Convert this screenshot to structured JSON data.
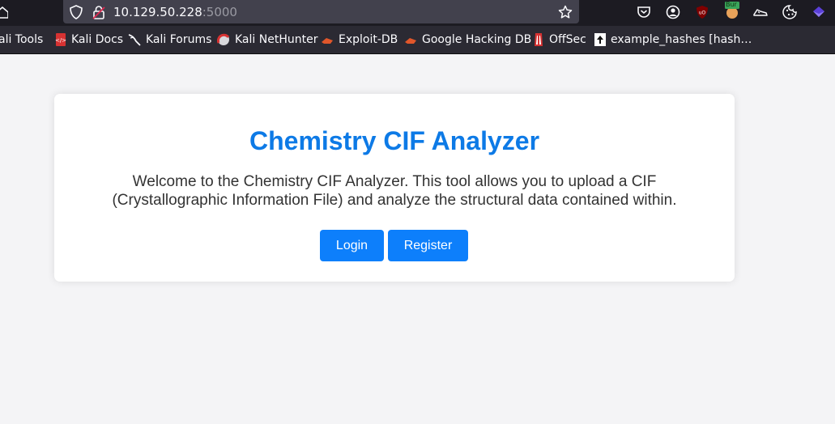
{
  "browser": {
    "url_host": "10.129.50.228",
    "url_port": ":5000",
    "bookmarks": [
      {
        "label": "ali Tools",
        "icon": "kali-tools-icon"
      },
      {
        "label": "Kali Docs",
        "icon": "kali-docs-icon"
      },
      {
        "label": "Kali Forums",
        "icon": "kali-forums-icon"
      },
      {
        "label": "Kali NetHunter",
        "icon": "kali-nethunter-icon"
      },
      {
        "label": "Exploit-DB",
        "icon": "exploit-db-icon"
      },
      {
        "label": "Google Hacking DB",
        "icon": "google-hacking-db-icon"
      },
      {
        "label": "OffSec",
        "icon": "offsec-icon"
      },
      {
        "label": "example_hashes [hash…",
        "icon": "hashcat-icon"
      }
    ],
    "extension_badge": "Bur"
  },
  "page": {
    "title": "Chemistry CIF Analyzer",
    "description": "Welcome to the Chemistry CIF Analyzer. This tool allows you to upload a CIF (Crystallographic Information File) and analyze the structural data contained within.",
    "login_label": "Login",
    "register_label": "Register"
  },
  "colors": {
    "title": "#0d7ae6",
    "button": "#0d7ffb",
    "background": "#f4f4f6"
  }
}
